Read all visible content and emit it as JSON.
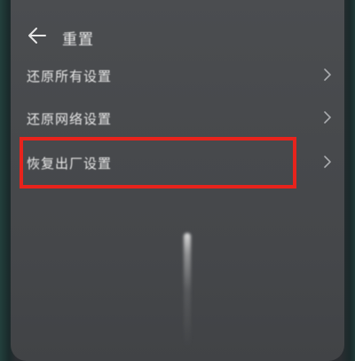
{
  "header": {
    "title": "重置"
  },
  "settings": {
    "items": [
      {
        "label": "还原所有设置"
      },
      {
        "label": "还原网络设置"
      },
      {
        "label": "恢复出厂设置"
      }
    ]
  },
  "icons": {
    "back": "arrow-left-icon",
    "chevron": "chevron-right-icon"
  },
  "colors": {
    "highlight": "#e8231c"
  }
}
